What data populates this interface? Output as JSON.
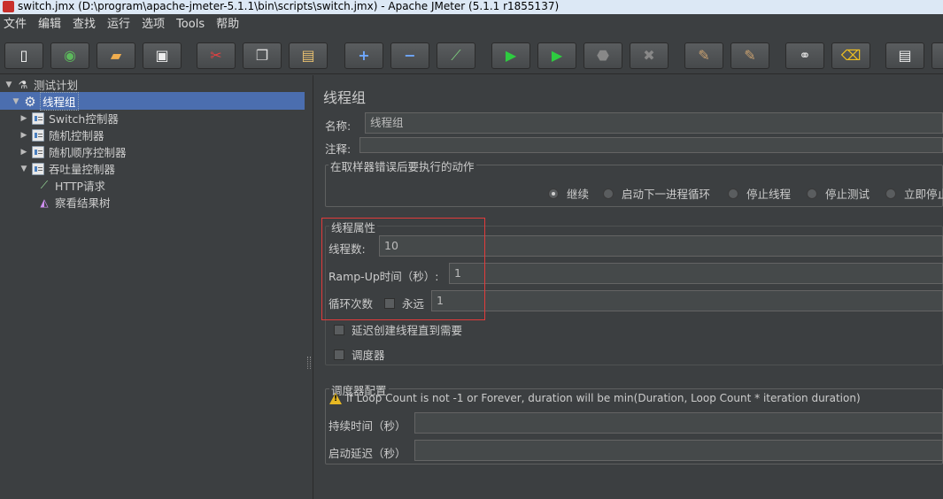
{
  "window": {
    "title": "switch.jmx (D:\\program\\apache-jmeter-5.1.1\\bin\\scripts\\switch.jmx) - Apache JMeter (5.1.1 r1855137)"
  },
  "menu": [
    "文件",
    "编辑",
    "查找",
    "运行",
    "选项",
    "Tools",
    "帮助"
  ],
  "toolbar": {
    "buttons": [
      "new-icon",
      "templates-icon",
      "open-icon",
      "save-icon",
      "cut-icon",
      "copy-icon",
      "paste-icon",
      "expand-icon",
      "collapse-icon",
      "toggle-icon",
      "start-icon",
      "start-no-pause-icon",
      "stop-icon",
      "shutdown-icon",
      "clear-icon",
      "clear-all-icon",
      "search-icon",
      "reset-search-icon",
      "function-helper-icon"
    ]
  },
  "tree": {
    "items": [
      {
        "label": "测试计划",
        "icon": "flask-icon"
      },
      {
        "label": "线程组",
        "icon": "gear-icon"
      },
      {
        "label": "Switch控制器",
        "icon": "controller-icon"
      },
      {
        "label": "随机控制器",
        "icon": "controller-icon"
      },
      {
        "label": "随机顺序控制器",
        "icon": "controller-icon"
      },
      {
        "label": "吞吐量控制器",
        "icon": "controller-icon"
      },
      {
        "label": "HTTP请求",
        "icon": "pipette-icon"
      },
      {
        "label": "察看结果树",
        "icon": "chart-icon"
      }
    ]
  },
  "main": {
    "title": "线程组",
    "name_label": "名称:",
    "name_value": "线程组",
    "comment_label": "注释:",
    "comment_value": "",
    "error_action": {
      "title": "在取样器错误后要执行的动作",
      "options": [
        "继续",
        "启动下一进程循环",
        "停止线程",
        "停止测试",
        "立即停止"
      ],
      "selected": "继续"
    },
    "thread_props": {
      "title": "线程属性",
      "threads_label": "线程数:",
      "threads_value": "10",
      "rampup_label": "Ramp-Up时间（秒）:",
      "rampup_value": "1",
      "loop_label": "循环次数",
      "forever_label": "永远",
      "loop_value": "1",
      "delay_label": "延迟创建线程直到需要",
      "scheduler_label": "调度器"
    },
    "scheduler_config": {
      "title": "调度器配置",
      "warning": "If Loop Count is not -1 or Forever, duration will be min(Duration, Loop Count * iteration duration)",
      "duration_label": "持续时间（秒）",
      "duration_value": "",
      "startup_label": "启动延迟（秒）",
      "startup_value": ""
    }
  },
  "colors": {
    "background": "#3c3f41",
    "selection": "#4b6eaf",
    "highlight_border": "#e23b3b"
  }
}
